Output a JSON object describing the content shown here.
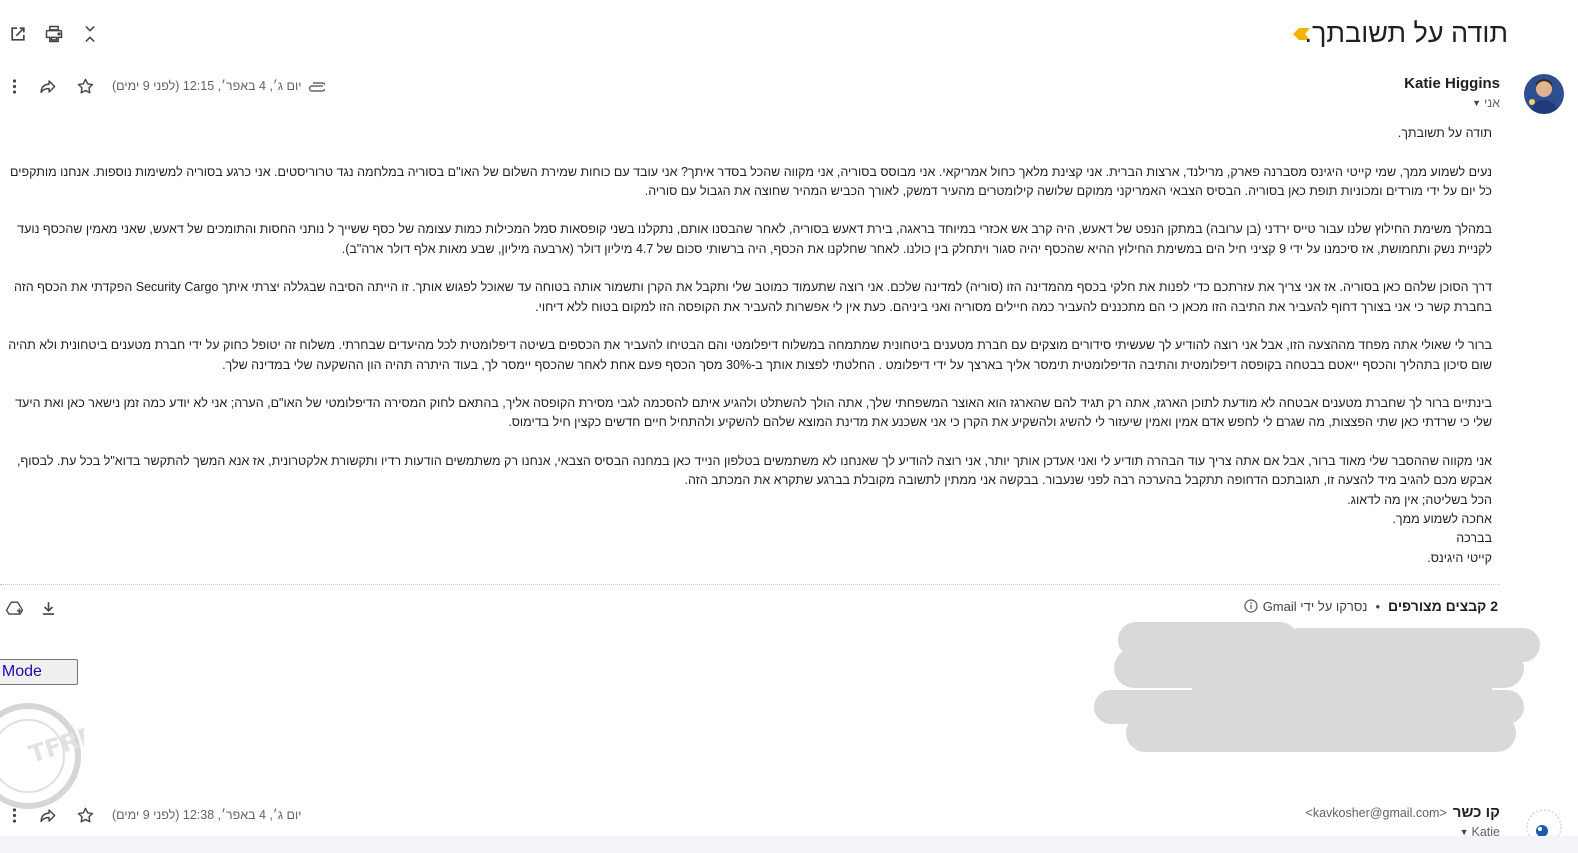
{
  "thread": {
    "subject": "תודה על תשובתך.",
    "tools": {
      "open_new_window": "open-in-new-window",
      "print": "print",
      "collapse": "collapse-all"
    }
  },
  "messages": [
    {
      "sender_name": "Katie Higgins",
      "sender_email": "",
      "recipient": "אני",
      "date": "יום ג׳, 4 באפר׳, 12:15 (לפני 9 ימים)",
      "has_attachment": true,
      "body": [
        "תודה על תשובתך.",
        "",
        "נעים לשמוע ממך, שמי קייטי היגינס מסברנה פארק, מרילנד, ארצות הברית. אני קצינת מלאך כחול אמריקאי. אני מבוסס בסוריה, אני מקווה שהכל בסדר איתך? אני עובד עם כוחות שמירת השלום של האו\"ם בסוריה במלחמה נגד טרוריסטים. אני כרגע בסוריה למשימות נוספות. אנחנו מותקפים כל יום על ידי מורדים ומכוניות תופת כאן בסוריה. הבסיס הצבאי האמריקני ממוקם שלושה קילומטרים מהעיר דמשק, לאורך הכביש המהיר שחוצה את הגבול עם סוריה.",
        "",
        "במהלך משימת החילוץ שלנו עבור טייס ירדני (בן ערובה) במתקן הנפט של דאעש, היה קרב אש אכזרי במיוחד בראגה, בירת דאעש בסוריה, לאחר שהבסנו אותם, נתקלנו בשני קופסאות סמל המכילות כמות עצומה של כסף ששייך ל נותני החסות והתומכים של דאעש, שאני מאמין שהכסף נועד לקניית נשק ותחמושת, אז סיכמנו על ידי 9 קציני חיל הים במשימת החילוץ ההיא שהכסף יהיה סגור ויתחלק בין כולנו. לאחר שחלקנו את הכסף, היה ברשותי סכום של 4.7 מיליון דולר (ארבעה מיליון, שבע מאות אלף דולר ארה\"ב).",
        "",
        "דרך הסוכן שלהם כאן בסוריה. אז אני צריך את עזרתכם כדי לפנות את חלקי בכסף מהמדינה הזו (סוריה) למדינה שלכם. אני רוצה שתעמוד כמוטב שלי ותקבל את הקרן ותשמור אותה בטוחה עד שאוכל לפגוש אותך. זו הייתה הסיבה שבגללה יצרתי איתך Security Cargo הפקדתי את הכסף הזה בחברת קשר כי אני בצורך דחוף להעביר את התיבה הזו מכאן כי הם מתכננים להעביר כמה חיילים מסוריה ואני ביניהם. כעת אין לי אפשרות להעביר את הקופסה הזו למקום בטוח ללא דיחוי.",
        "",
        "ברור לי שאולי אתה מפחד מההצעה הזו, אבל אני רוצה להודיע לך שעשיתי סידורים מוצקים עם חברת מטענים ביטחונית שמתמחה במשלוח דיפלומטי והם הבטיחו להעביר את הכספים בשיטה דיפלומטית לכל מהיעדים שבחרתי. משלוח זה יטופל כחוק על ידי חברת מטענים ביטחונית ולא תהיה שום סיכון בתהליך והכסף ייאטם בבטחה בקופסה דיפלומטית והתיבה הדיפלומטית תימסר אליך בארצך על ידי דיפלומט . החלטתי לפצות אותך ב-30% מסך הכסף פעם אחת לאחר שהכסף יימסר לך, בעוד היתרה תהיה הון ההשקעה שלי במדינה שלך.",
        "",
        "בינתיים ברור לך שחברת מטענים אבטחה לא מודעת לתוכן הארגז, אתה רק תגיד להם שהארגז הוא האוצר המשפחתי שלך, אתה הולך להשתלט ולהגיע איתם להסכמה לגבי מסירת הקופסה אליך, בהתאם לחוק המסירה הדיפלומטי של האו\"ם, הערה; אני לא יודע כמה זמן נישאר כאן ואת היעד שלי כי שרדתי כאן שתי הפצצות, מה שגרם לי לחפש אדם אמין ואמין שיעזור לי להשיג ולהשקיע את הקרן כי אני אשכנע את מדינת המוצא שלהם להשקיע ולהתחיל חיים חדשים כקצין חיל בדימוס.",
        "",
        "אני מקווה שההסבר שלי מאוד ברור, אבל אם אתה צריך עוד הבהרה תודיע לי ואני אעדכן אותך יותר, אני רוצה להודיע לך שאנחנו לא משתמשים בטלפון הנייד כאן במחנה הבסיס הצבאי, אנחנו רק משתמשים הודעות רדיו ותקשורת אלקטרונית, אז אנא המשך להתקשר בדוא\"ל בכל עת. לבסוף, אבקש מכם להגיב מיד להצעה זו, תגובתכם הדחופה תתקבל בהערכה רבה לפני שנעבור. בבקשה אני ממתין לתשובה מקובלת בברגע שתקרא את המכתב הזה.",
        "הכל בשליטה; אין מה לדאוג.",
        "אחכה לשמוע ממך.",
        "בברכה",
        "קייטי היגינס."
      ],
      "attachments": {
        "count_label": "2 קבצים מצורפים",
        "separator": "•",
        "scan_note": "נסרקו על ידי Gmail",
        "actions": [
          "add-to-drive",
          "download-all"
        ]
      }
    },
    {
      "sender_name": "קו כשר",
      "sender_email": "<kavkosher@gmail.com>",
      "recipient": "Katie",
      "date": "יום ג׳, 4 באפר׳, 12:38 (לפני 9 ימים)",
      "has_attachment": false
    }
  ],
  "overlay": {
    "mode_button_label": "ow Mode"
  },
  "colors": {
    "importance": "#f4b400",
    "link": "#1a0dab",
    "muted": "#5f6368",
    "redaction": "#d9d9d9"
  }
}
